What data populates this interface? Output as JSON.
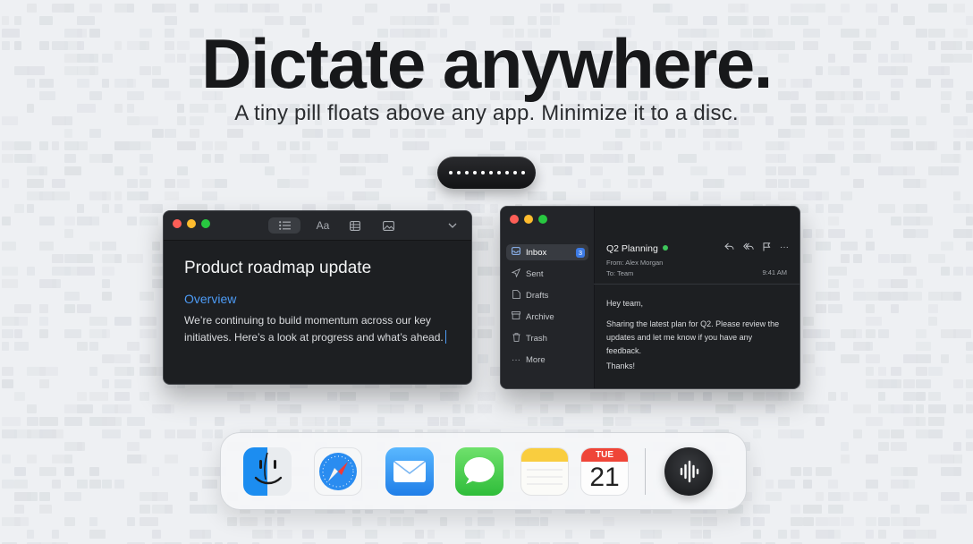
{
  "hero": {
    "headline": "Dictate anywhere.",
    "subhead": "A tiny pill floats above any app. Minimize it to a disc."
  },
  "pill": {
    "icon": "waveform-dots-icon"
  },
  "notes_window": {
    "toolbar_icons": [
      "list-icon",
      "text-format-icon",
      "table-icon",
      "image-icon",
      "chevron-down-icon"
    ],
    "format_label": "Aa",
    "title": "Product roadmap update",
    "subheading": "Overview",
    "body": "We’re continuing to build momentum across our key initiatives. Here’s a look at progress and what’s ahead."
  },
  "mail_window": {
    "sidebar": [
      {
        "label": "Inbox",
        "icon": "inbox-icon",
        "badge": "3"
      },
      {
        "label": "Sent",
        "icon": "paper-plane-icon"
      },
      {
        "label": "Drafts",
        "icon": "document-icon"
      },
      {
        "label": "Archive",
        "icon": "archive-icon"
      },
      {
        "label": "Trash",
        "icon": "trash-icon"
      },
      {
        "label": "More",
        "icon": "ellipsis-icon"
      }
    ],
    "subject": "Q2 Planning",
    "from": "From: Alex Morgan",
    "to": "To: Team",
    "time": "9:41 AM",
    "greeting": "Hey team,",
    "body": "Sharing the latest plan for Q2. Please review the updates and let me know if you have any feedback.",
    "signoff": "Thanks!"
  },
  "dock": {
    "apps": [
      {
        "name": "Finder",
        "icon": "finder-icon"
      },
      {
        "name": "Safari",
        "icon": "safari-icon"
      },
      {
        "name": "Mail",
        "icon": "mail-icon"
      },
      {
        "name": "Messages",
        "icon": "messages-icon"
      },
      {
        "name": "Notes",
        "icon": "notes-icon"
      },
      {
        "name": "Calendar",
        "icon": "calendar-icon"
      },
      {
        "name": "Dictation",
        "icon": "waveform-icon"
      }
    ],
    "calendar_day": "TUE",
    "calendar_date": "21"
  },
  "colors": {
    "accent_blue": "#4d9bf5",
    "badge_blue": "#3d7be6",
    "online_green": "#3ec65b",
    "window_bg": "#1d1f22"
  }
}
